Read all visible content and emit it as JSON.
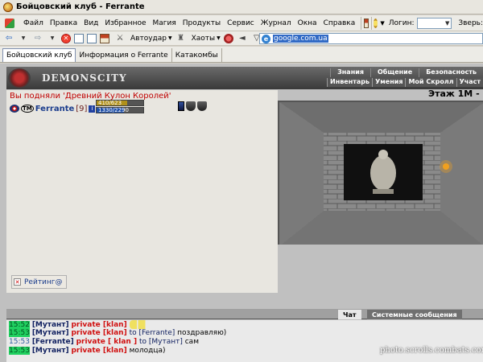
{
  "window": {
    "title": "Бойцовский клуб - Ferrante"
  },
  "menubar": {
    "items": [
      "Файл",
      "Правка",
      "Вид",
      "Избранное",
      "Магия",
      "Продукты",
      "Сервис",
      "Журнал",
      "Окна",
      "Справка"
    ],
    "login_label": "Логин:",
    "login_value": "",
    "zver_label": "Зверь:"
  },
  "toolbar": {
    "autoudar_label": "Автоудар",
    "haoty_label": "Хаоты",
    "address": "google.com.ua"
  },
  "tabs": [
    {
      "label": "Бойцовский клуб",
      "active": true
    },
    {
      "label": "Информация о Ferrante",
      "active": false
    },
    {
      "label": "Катакомбы",
      "active": false
    }
  ],
  "game_header": {
    "logo": "DEMONSCITY",
    "nav_top": [
      "Знания",
      "Общение",
      "Безопасность"
    ],
    "nav_bottom": [
      "Инвентарь",
      "Умения",
      "Мой Скролл",
      "Участ"
    ]
  },
  "left_panel": {
    "message": "Вы подняли 'Древний Кулон Королей'",
    "character": {
      "name": "Ferrante",
      "level": "[9]"
    },
    "hp": {
      "text": "410/623",
      "fraction": 0.658
    },
    "mp": {
      "text": "1330/2290",
      "fraction": 0.581
    },
    "rating_button": "Рейтинг@"
  },
  "dungeon": {
    "floor_label": "Этаж 1М -"
  },
  "chat": {
    "tabs": [
      "Чат",
      "Системные сообщения"
    ],
    "lines": [
      {
        "time": "15:52",
        "ts_style": "green",
        "nick": "[Мутант]",
        "private": "private [klan]",
        "to": "",
        "msg": "",
        "smiley": true
      },
      {
        "time": "15:53",
        "ts_style": "green",
        "nick": "[Мутант]",
        "private": "private [klan]",
        "to": "to [Ferrante]",
        "msg": "поздравляю)",
        "smiley": false
      },
      {
        "time": "15:53",
        "ts_style": "plain",
        "nick": "[Ferrante]",
        "private": "private [ klan ]",
        "to": "to [Мутант]",
        "msg": "сам",
        "smiley": false
      },
      {
        "time": "15:53",
        "ts_style": "green",
        "nick": "[Мутант]",
        "private": "private [klan]",
        "to": "",
        "msg": "молодца)",
        "smiley": false
      }
    ]
  },
  "watermark": "photo.scrolls.combats.com",
  "colors": {
    "chat_ts_bg": "#20d060",
    "private": "#d01010",
    "nick": "#102060",
    "hp": "#b0901a",
    "mp": "#2050a8"
  }
}
